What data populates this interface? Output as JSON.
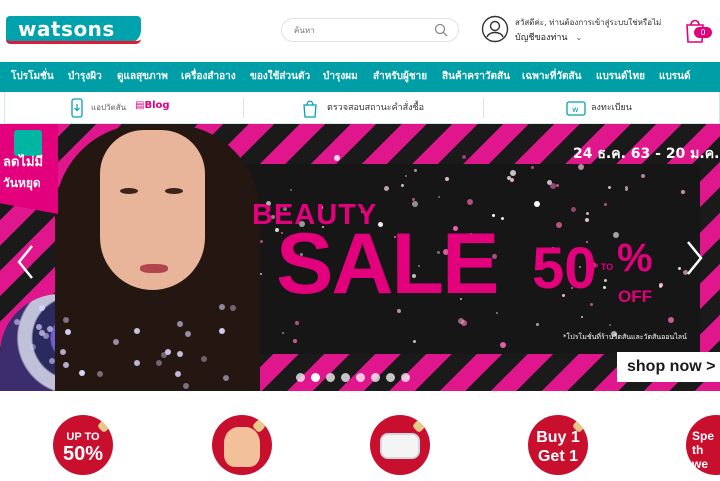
{
  "header": {
    "logo_text": "watsons",
    "search_placeholder": "ค้นหา",
    "greeting": "สวัสดีค่ะ, ท่านต้องการเข้าสู่ระบบใช่หรือไม่",
    "account_label": "บัญชีของท่าน",
    "cart_count": "0"
  },
  "nav": {
    "items": [
      "โปรโมชั่น",
      "บำรุงผิว",
      "ดูแลสุขภาพ",
      "เครื่องสำอาง",
      "ของใช้ส่วนตัว",
      "บำรุงผม",
      "สำหรับผู้ชาย",
      "สินค้าคราวัตสัน",
      "เฉพาะที่วัตสัน",
      "แบรนด์ไทย",
      "แบรนด์"
    ]
  },
  "strip": {
    "blog_label": "Blog",
    "app_label": "แอปวัตสัน",
    "order_label": "ตรวจสอบสถานะคำสั่งซื้อ",
    "register_label": "ลงทะเบียน"
  },
  "banner": {
    "promo_line1": "ลดไม่มี",
    "promo_line2": "วันหยุด",
    "date": "24 ธ.ค. 63 - 20 ม.ค. 64",
    "beauty": "BEAUTY",
    "sale": "SALE",
    "discount_number": "50",
    "up_to": "UP TO",
    "off": "OFF",
    "note": "*โปรโมชั่นที่ร้านวัตสันและวัตสันออนไลน์",
    "shop_now": "shop now >",
    "slide_count": 8,
    "active_slide": 1
  },
  "categories": [
    {
      "line1": "UP TO",
      "line2": "50%",
      "icon": "discount-badge"
    },
    {
      "line1": "",
      "line2": "",
      "icon": "glove-icon"
    },
    {
      "line1": "",
      "line2": "",
      "icon": "mask-icon"
    },
    {
      "line1": "Buy 1",
      "line2": "Get 1",
      "icon": "buy1get1-badge"
    },
    {
      "line1": "Spe",
      "line2": "th",
      "line3": "we",
      "icon": "special-badge"
    }
  ],
  "colors": {
    "brand_teal": "#009ea7",
    "brand_pink": "#e3007c",
    "category_red": "#c8102e"
  }
}
